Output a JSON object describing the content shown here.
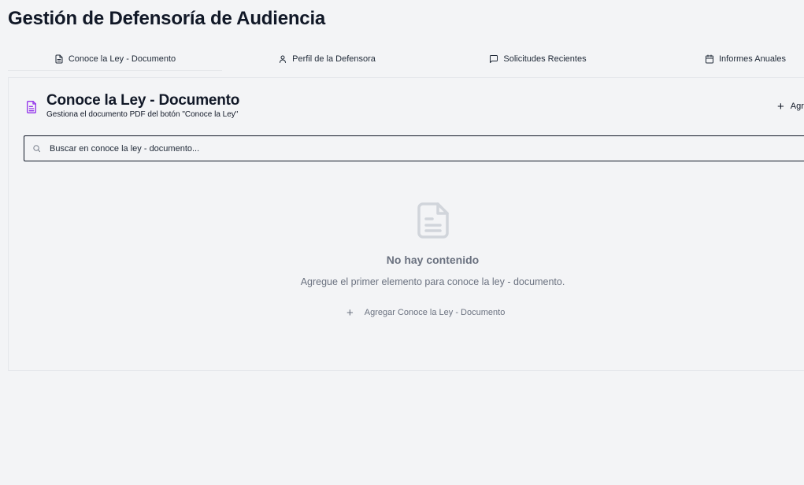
{
  "page": {
    "title": "Gestión de Defensoría de Audiencia"
  },
  "tabs": [
    {
      "label": "Conoce la Ley - Documento",
      "icon": "document-icon",
      "active": true
    },
    {
      "label": "Perfil de la Defensora",
      "icon": "user-icon",
      "active": false
    },
    {
      "label": "Solicitudes Recientes",
      "icon": "message-icon",
      "active": false
    },
    {
      "label": "Informes Anuales",
      "icon": "calendar-icon",
      "active": false
    }
  ],
  "panel": {
    "icon": "document-icon",
    "title": "Conoce la Ley - Documento",
    "subtitle": "Gestiona el documento PDF del botón \"Conoce la Ley\"",
    "add_label": "Agregar",
    "search_placeholder": "Buscar en conoce la ley - documento...",
    "empty": {
      "icon": "document-icon",
      "title": "No hay contenido",
      "description": "Agregue el primer elemento para conoce la ley - documento.",
      "add_label": "Agregar Conoce la Ley - Documento"
    }
  },
  "colors": {
    "accent": "#9333ea",
    "muted": "#6b7280",
    "empty_icon": "#d1d5db",
    "background": "#f3f4f6"
  }
}
